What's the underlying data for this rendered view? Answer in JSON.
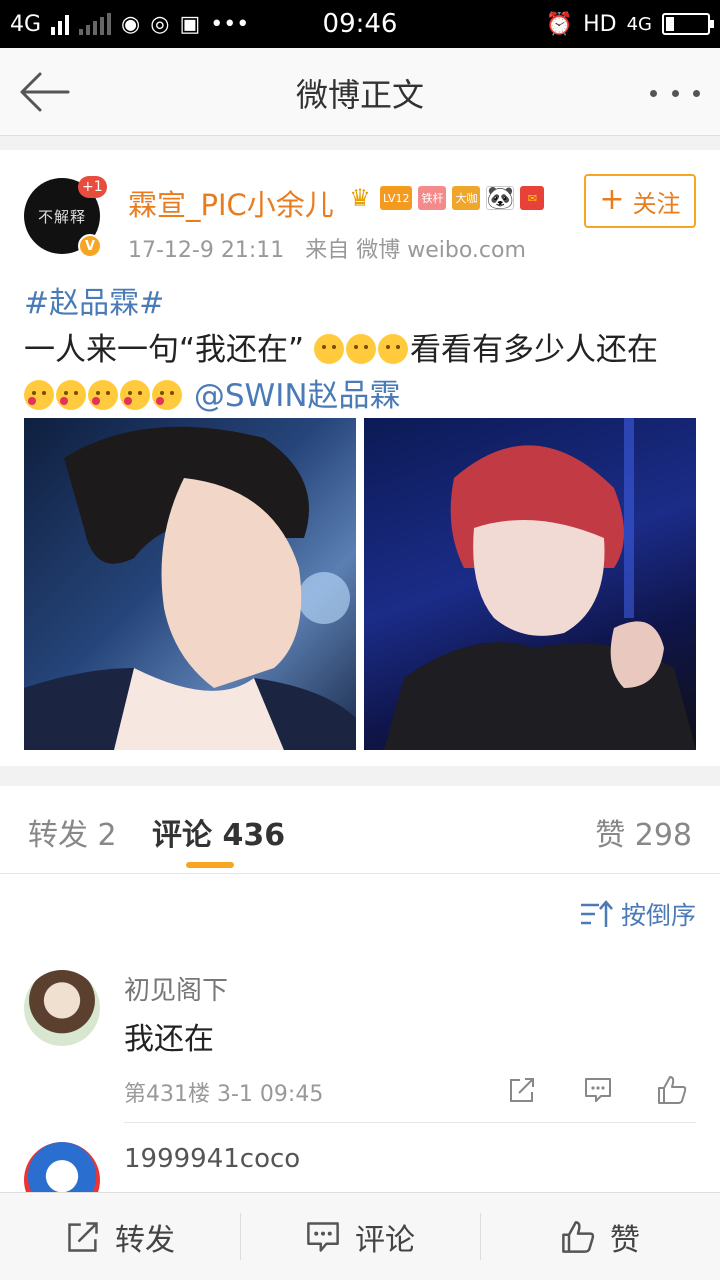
{
  "status_bar": {
    "network_left": "4G",
    "time": "09:46",
    "hd": "HD",
    "network_right": "4G",
    "left_icons": [
      "signal-bars-icon",
      "weibo-icon",
      "wechat-icon",
      "payment-app-icon",
      "more-dots"
    ],
    "right_icons": [
      "alarm-icon",
      "battery-icon"
    ]
  },
  "navbar": {
    "title": "微博正文"
  },
  "post": {
    "avatar_text": "不解释",
    "notify_badge": "+1",
    "username": "霖宣_PIC小余儿",
    "user_badges": [
      "crown-badge",
      "LV12",
      "铁杆",
      "大咖",
      "panda-badge",
      "red-envelope-badge"
    ],
    "timestamp": "17-12-9 21:11",
    "source": "来自 微博 weibo.com",
    "follow_label": "关注",
    "hashtag": "#赵品霖#",
    "text_line1": "一人来一句“我还在”",
    "text_line1_tail": "看看有多少人还在",
    "mention": "@SWIN赵品霖",
    "emoji_line1_count": 3,
    "emoji_line2_count": 5
  },
  "tabs": {
    "repost": "转发 2",
    "comments": "评论 436",
    "likes": "赞 298",
    "active": "comments"
  },
  "comments": {
    "sort_label": "按倒序",
    "items": [
      {
        "name": "初见阁下",
        "body": "我还在",
        "meta": "第431楼 3-1 09:45"
      },
      {
        "name": "1999941coco"
      }
    ]
  },
  "bottom_bar": {
    "repost": "转发",
    "comment": "评论",
    "like": "赞"
  },
  "colors": {
    "accent_orange": "#e87c1e",
    "follow_border": "#f6a623",
    "link_blue": "#4b7bb6"
  }
}
